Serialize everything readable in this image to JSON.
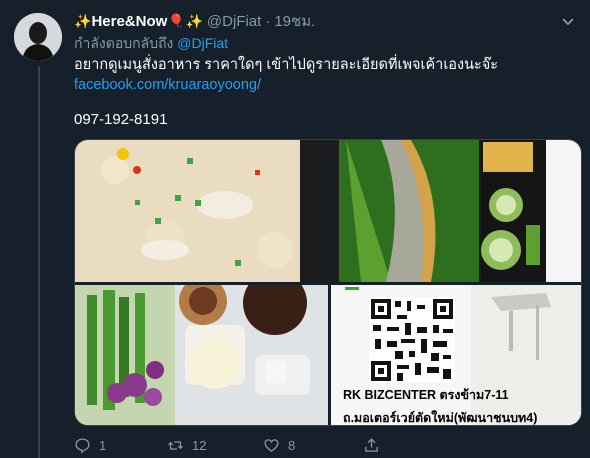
{
  "tweet": {
    "display_name": "Here&Now",
    "handle": "@DjFiat",
    "separator": "·",
    "time": "19ชม.",
    "reply_prefix": "กำลังตอบกลับถึง",
    "reply_mention": "@DjFiat",
    "text_line1": "อยากดูเมนูสั่งอาหาร ราคาใดๆ เข้าไปดูรายละเอียดที่เพจเค้าเองนะจ๊ะ",
    "link": "facebook.com/kruaraoyoong/",
    "phone": "097-192-8191"
  },
  "media": {
    "card_line1": "RK BIZCENTER ตรงข้าม7-11",
    "card_line2": "ถ.มอเตอร์เวย์ตัดใหม่(พัฒนาชนบท4)"
  },
  "actions": {
    "reply_count": "1",
    "retweet_count": "12",
    "like_count": "8"
  },
  "icons": [
    "sparkles-icon",
    "balloon-icon",
    "caret-down-icon",
    "reply-icon",
    "retweet-icon",
    "like-icon",
    "share-icon"
  ],
  "colors": {
    "background": "#15202b",
    "accent": "#1da1f2",
    "muted": "#8899a6"
  }
}
